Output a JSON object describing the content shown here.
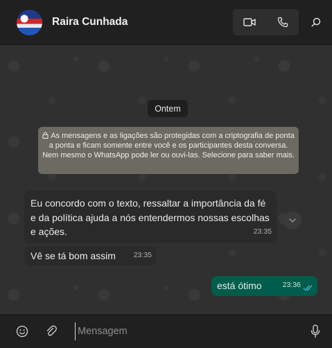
{
  "header": {
    "contact_name": "Raira Cunhada",
    "avatar_icon": "contact-photo",
    "video_call_icon": "video-camera-icon",
    "voice_call_icon": "phone-icon",
    "search_icon": "search-icon"
  },
  "chat": {
    "date_label": "Ontem",
    "system_note": "As mensagens e as ligações são protegidas com a criptografia de ponta a ponta e ficam somente entre você e os participantes desta conversa. Nem mesmo o WhatsApp pode ler ou ouvi-las. Selecione para saber mais.",
    "messages": [
      {
        "direction": "in",
        "text": "Eu concordo com o texto, ressaltar a importância da fé e da política ajuda a nós entendermos nossas escolhas e ações.",
        "time": "23:35"
      },
      {
        "direction": "in",
        "text": "Vê se tá bom assim",
        "time": "23:35"
      },
      {
        "direction": "out",
        "text": "está ótimo",
        "time": "23:36",
        "status": "read"
      }
    ]
  },
  "composer": {
    "placeholder": "Mensagem",
    "value": ""
  },
  "colors": {
    "outgoing_bubble": "#005c4b",
    "incoming_bubble": "#2a2a2a",
    "system_note": "#6b6a63",
    "read_ticks": "#53bdeb"
  }
}
